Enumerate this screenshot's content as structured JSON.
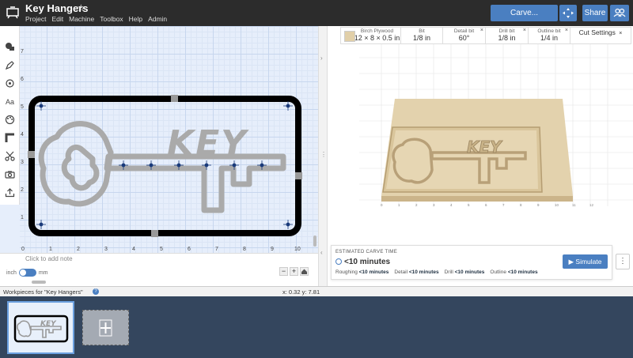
{
  "header": {
    "title": "Key Hangers",
    "menu": [
      "Project",
      "Edit",
      "Machine",
      "Toolbox",
      "Help",
      "Admin"
    ],
    "carve_label": "Carve...",
    "share_label": "Share"
  },
  "design": {
    "x_ticks": [
      "0",
      "1",
      "2",
      "3",
      "4",
      "5",
      "6",
      "7",
      "8",
      "9",
      "10"
    ],
    "y_ticks": [
      "7",
      "6",
      "5",
      "4",
      "3",
      "2",
      "1"
    ],
    "text": "KEY",
    "add_note": "Click to add note",
    "unit_inch": "inch",
    "unit_mm": "mm",
    "zoom_out": "−",
    "zoom_in": "+"
  },
  "bits": {
    "material_label": "Birch Plywood",
    "material_value": "12 × 8 × 0.5 in",
    "bit_label": "Bit",
    "bit_value": "1/8 in",
    "detail_label": "Detail bit",
    "detail_value": "60°",
    "drill_label": "Drill bit",
    "drill_value": "1/8 in",
    "outline_label": "Outline bit",
    "outline_value": "1/4 in",
    "cut_settings": "Cut Settings",
    "material_color": "#e1cfa8"
  },
  "carve_time": {
    "label": "ESTIMATED CARVE TIME",
    "total": "<10 minutes",
    "roughing_label": "Roughing",
    "roughing_value": "<10 minutes",
    "detail_label": "Detail",
    "detail_value": "<10 minutes",
    "drill_label": "Drill",
    "drill_value": "<10 minutes",
    "outline_label": "Outline",
    "outline_value": "<10 minutes",
    "simulate_label": "Simulate"
  },
  "workpieces": {
    "title": "Workpieces for \"Key Hangers\"",
    "coords": "x: 0.32 y: 7.81"
  },
  "preview_x_ticks": [
    "0",
    "1",
    "2",
    "3",
    "4",
    "5",
    "6",
    "7",
    "8",
    "9",
    "10",
    "11",
    "12"
  ],
  "colors": {
    "accent": "#4a7fc1",
    "topbar": "#2c2c2c",
    "workpiece_bg": "#34465e"
  }
}
